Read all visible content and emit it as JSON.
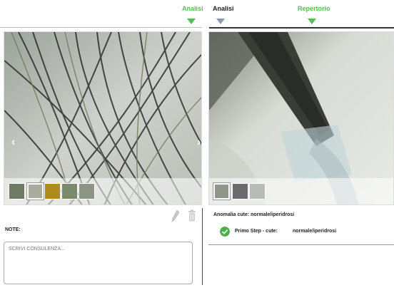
{
  "tabs": {
    "left": "Analisi",
    "middle": "Analisi",
    "right": "Repertorio"
  },
  "colors": {
    "accent_green": "#5cb85c",
    "inactive_marker": "#8a9bb0",
    "check_green": "#4cae4c"
  },
  "gallery_left": {
    "prev_icon": "chevron-left-icon",
    "next_icon": "chevron-right-icon",
    "thumbnails": [
      "thumb-1",
      "thumb-2",
      "thumb-3",
      "thumb-4",
      "thumb-5"
    ]
  },
  "gallery_right": {
    "thumbnails": [
      "thumb-1",
      "thumb-2",
      "thumb-3"
    ]
  },
  "tools": {
    "edit_icon": "pencil-icon",
    "delete_icon": "trash-icon"
  },
  "notes": {
    "label": "NOTE:",
    "placeholder": "SCRIVI CONSULENZA..."
  },
  "analysis": {
    "anomaly_label": "Anomalia cute: normale/iperidrosi",
    "steps": [
      {
        "name": "Primo Step - cute:",
        "value": "normale/iperidrosi",
        "status_icon": "check-circle-icon"
      }
    ]
  }
}
